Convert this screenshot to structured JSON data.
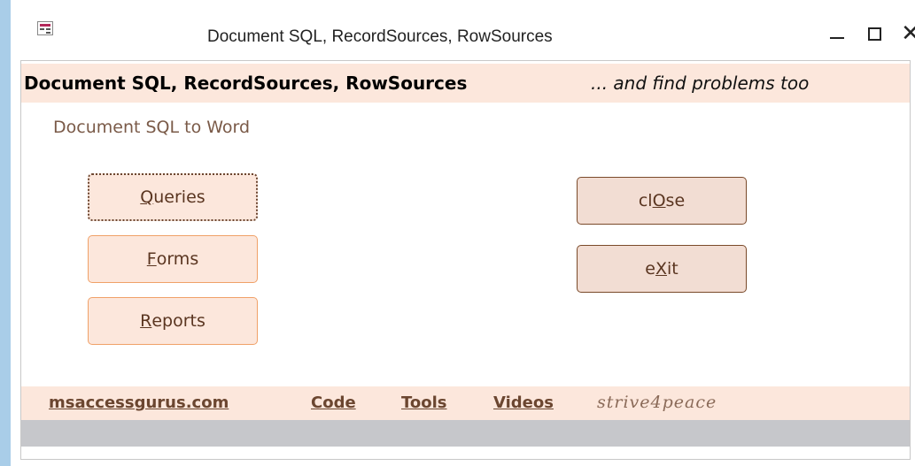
{
  "window": {
    "title": "Document SQL, RecordSources, RowSources",
    "app_icon": "form-icon",
    "controls": {
      "minimize": "—",
      "maximize": "□",
      "close": "✕"
    }
  },
  "header": {
    "title": "Document SQL, RecordSources, RowSources",
    "subtitle": "... and find problems too"
  },
  "section_label": "Document SQL to Word",
  "buttons": {
    "queries": {
      "pre": "",
      "key": "Q",
      "post": "ueries"
    },
    "forms": {
      "pre": "",
      "key": "F",
      "post": "orms"
    },
    "reports": {
      "pre": "",
      "key": "R",
      "post": "eports"
    },
    "close": {
      "pre": "cl",
      "key": "O",
      "post": "se"
    },
    "exit": {
      "pre": "e",
      "key": "X",
      "post": "it"
    }
  },
  "footer": {
    "site": "msaccessgurus.com",
    "code": "Code",
    "tools": "Tools",
    "videos": "Videos",
    "tagline": "strive4peace"
  },
  "colors": {
    "band": "#fce7dc",
    "left_button_border": "#f0a168",
    "right_button_fill": "#f2ddd3",
    "right_button_border": "#7a4a2a",
    "text_brown": "#6b4630",
    "status_gray": "#c6c7cb",
    "desktop": "#a9cde8"
  }
}
